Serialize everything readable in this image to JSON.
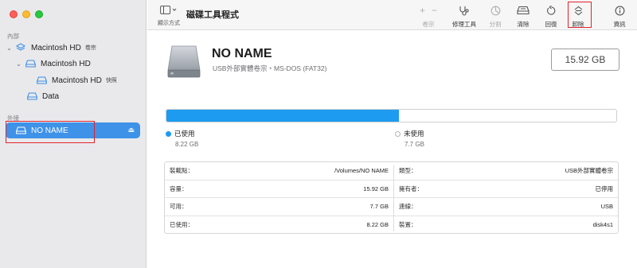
{
  "sidebar": {
    "internal_label": "內部",
    "external_label": "外接",
    "items": [
      {
        "label": "Macintosh HD",
        "sub": "卷宗"
      },
      {
        "label": "Macintosh HD",
        "sub": ""
      },
      {
        "label": "Macintosh HD",
        "sub": "快照"
      },
      {
        "label": "Data",
        "sub": ""
      },
      {
        "label": "NO NAME",
        "sub": ""
      }
    ]
  },
  "toolbar": {
    "view_label": "顯示方式",
    "app_title": "磁碟工具程式",
    "volume_label": "卷宗",
    "firstaid_label": "修理工具",
    "partition_label": "分割",
    "erase_label": "清除",
    "restore_label": "回復",
    "unmount_label": "卸除",
    "info_label": "資訊",
    "add_symbol": "+",
    "remove_symbol": "−"
  },
  "disk": {
    "name": "NO NAME",
    "description": "USB外部實體卷宗・MS-DOS (FAT32)",
    "capacity": "15.92 GB"
  },
  "usage": {
    "used_fraction": 0.516,
    "used_label": "已使用",
    "used_value": "8.22 GB",
    "free_label": "未使用",
    "free_value": "7.7 GB",
    "used_color": "#1d9bf0"
  },
  "info": {
    "left": [
      {
        "k": "裝載點：",
        "v": "/Volumes/NO NAME"
      },
      {
        "k": "容量：",
        "v": "15.92 GB"
      },
      {
        "k": "可用：",
        "v": "7.7 GB"
      },
      {
        "k": "已使用：",
        "v": "8.22 GB"
      }
    ],
    "right": [
      {
        "k": "類型：",
        "v": "USB外部實體卷宗"
      },
      {
        "k": "擁有者：",
        "v": "已停用"
      },
      {
        "k": "連線：",
        "v": "USB"
      },
      {
        "k": "裝置：",
        "v": "disk4s1"
      }
    ]
  }
}
